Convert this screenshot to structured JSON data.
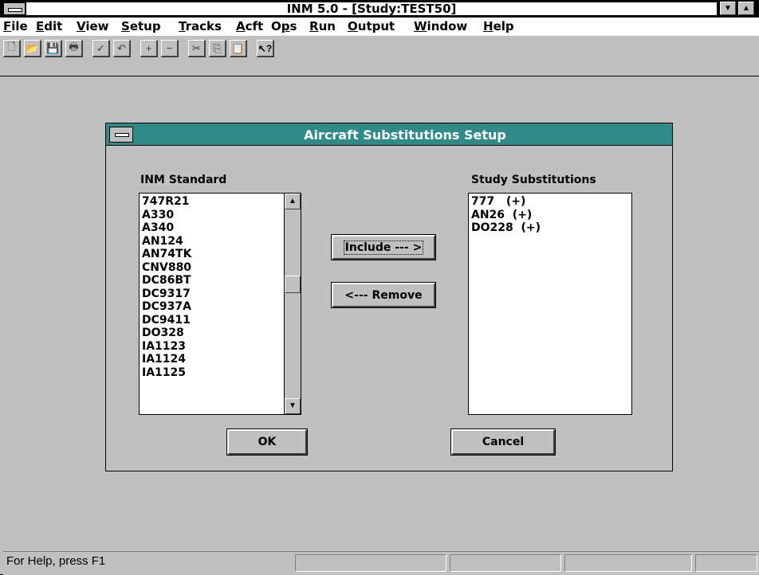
{
  "window": {
    "title": "INM 5.0 - [Study:TEST50]"
  },
  "menu": {
    "items": [
      "File",
      "Edit",
      "View",
      "Setup",
      "Tracks",
      "Acft",
      "Ops",
      "Run",
      "Output",
      "Window",
      "Help"
    ],
    "mnemonics": [
      "F",
      "E",
      "V",
      "S",
      "T",
      "A",
      "p",
      "R",
      "O",
      "W",
      "H"
    ]
  },
  "toolbar": {
    "icons": [
      "new-file-icon",
      "open-folder-icon",
      "save-disk-icon",
      "print-icon",
      "check-icon",
      "undo-icon",
      "plus-icon",
      "minus-icon",
      "cut-icon",
      "copy-icon",
      "paste-icon",
      "context-help-icon"
    ]
  },
  "dialog": {
    "title": "Aircraft Substitutions Setup",
    "left_list_label": "INM Standard",
    "right_list_label": "Study Substitutions",
    "left_items": [
      "747R21",
      "A330",
      "A340",
      "AN124",
      "AN74TK",
      "CNV880",
      "DC86BT",
      "DC9317",
      "DC937A",
      "DC9411",
      "DO328",
      "IA1123",
      "IA1124",
      "IA1125"
    ],
    "right_items": [
      "777   (+)",
      "AN26  (+)",
      "DO228  (+)"
    ],
    "include_label": "Include --- >",
    "remove_label": "<--- Remove",
    "ok_label": "OK",
    "cancel_label": "Cancel"
  },
  "status": {
    "text": "For Help, press F1"
  }
}
